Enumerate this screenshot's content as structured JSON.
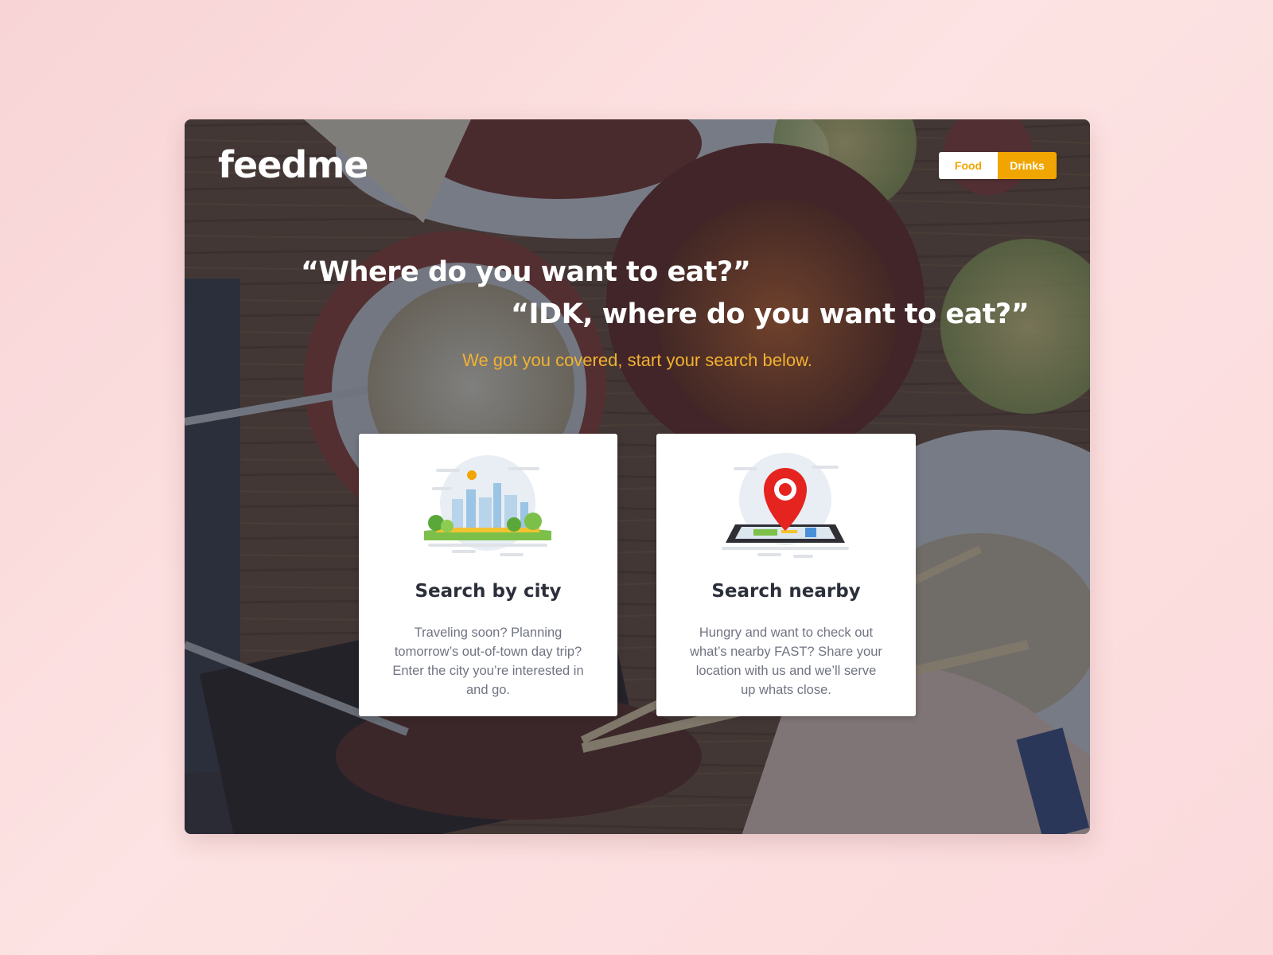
{
  "app": {
    "logo": "feedme"
  },
  "toggle": {
    "food_label": "Food",
    "drinks_label": "Drinks",
    "active": "Drinks"
  },
  "hero": {
    "quote_1": "“Where do you want to eat?”",
    "quote_2": "“IDK, where do you want to eat?”",
    "subtitle": "We got you covered, start your search below."
  },
  "cards": [
    {
      "title": "Search by city",
      "description": "Traveling soon? Planning tomorrow’s out-of-town day trip? Enter the city you’re interested in and go.",
      "icon": "city-illustration-icon"
    },
    {
      "title": "Search nearby",
      "description": "Hungry and want to check out what’s nearby FAST? Share your location with us and we’ll serve up whats close.",
      "icon": "map-pin-phone-icon"
    }
  ],
  "colors": {
    "accent": "#f0a500",
    "subtitle": "#f2b230",
    "page_bg": "#fbdcdd",
    "overlay": "#1e263a",
    "pin_red": "#e52420"
  }
}
